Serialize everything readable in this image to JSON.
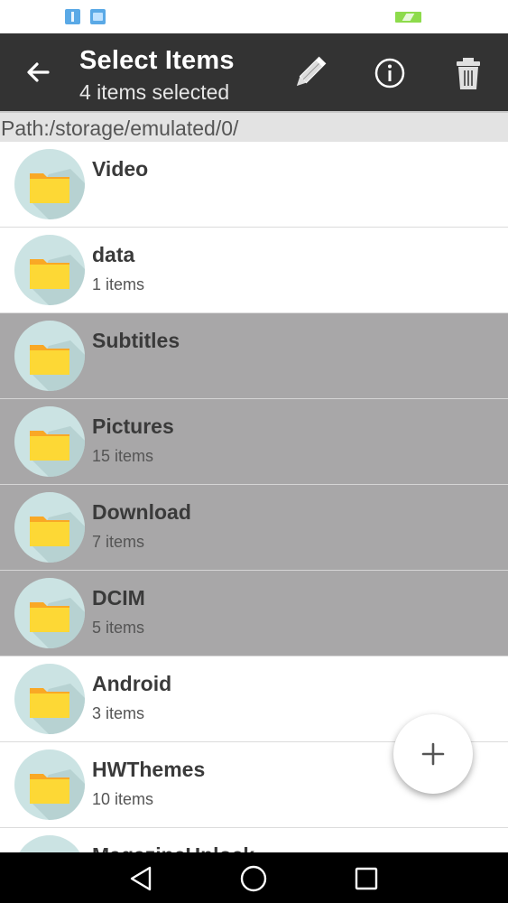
{
  "status_bar": {
    "icons": [
      "usb-icon",
      "gallery-icon",
      "battery-charging-icon"
    ],
    "battery_color": "#8ddb4b"
  },
  "app_bar": {
    "title": "Select Items",
    "subtitle": "4 items selected",
    "background": "#333333",
    "actions": [
      "edit-icon",
      "info-icon",
      "delete-icon"
    ]
  },
  "path_bar": {
    "text": "Path:/storage/emulated/0/"
  },
  "files": [
    {
      "name": "Video",
      "meta": "",
      "selected": false
    },
    {
      "name": "data",
      "meta": "1 items",
      "selected": false
    },
    {
      "name": "Subtitles",
      "meta": "",
      "selected": true
    },
    {
      "name": "Pictures",
      "meta": "15 items",
      "selected": true
    },
    {
      "name": "Download",
      "meta": "7 items",
      "selected": true
    },
    {
      "name": "DCIM",
      "meta": "5 items",
      "selected": true
    },
    {
      "name": "Android",
      "meta": "3 items",
      "selected": false
    },
    {
      "name": "HWThemes",
      "meta": "10 items",
      "selected": false
    },
    {
      "name": "MagazineUnlock",
      "meta": "",
      "selected": false
    }
  ],
  "colors": {
    "selected_row": "#a8a7a8",
    "folder": "#fbc02d",
    "folder_circle": "#cbe3e3"
  },
  "fab": {
    "icon": "plus-icon"
  },
  "nav_bar": {
    "icons": [
      "nav-back-icon",
      "nav-home-icon",
      "nav-recents-icon"
    ]
  }
}
